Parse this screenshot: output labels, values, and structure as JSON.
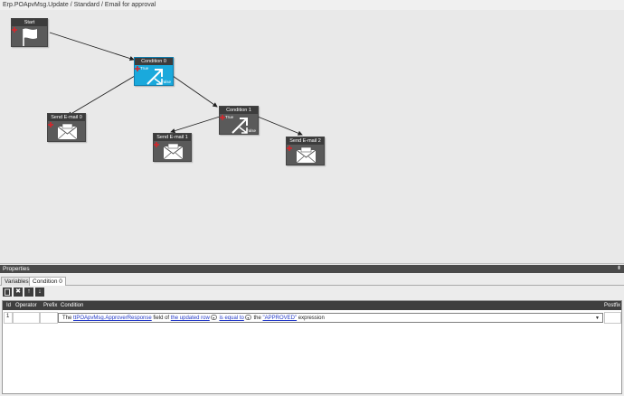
{
  "header": {
    "breadcrumb": "Erp.POApvMsg.Update / Standard / Email for approval"
  },
  "workflow": {
    "nodes": {
      "start": {
        "title": "Start",
        "icon": "flag-icon"
      },
      "condition_0": {
        "title": "Condition 0",
        "icon": "branch-arrow-icon",
        "true_label": "True",
        "false_label": "False",
        "selected": true
      },
      "condition_1": {
        "title": "Condition 1",
        "icon": "branch-arrow-icon",
        "true_label": "True",
        "false_label": "False"
      },
      "email_0": {
        "title": "Send E-mail 0",
        "icon": "envelope-icon"
      },
      "email_1": {
        "title": "Send E-mail 1",
        "icon": "envelope-icon"
      },
      "email_2": {
        "title": "Send E-mail 2",
        "icon": "envelope-icon"
      }
    },
    "connections": [
      {
        "from": "Start",
        "to": "Condition 0"
      },
      {
        "from": "Condition 0 (True)",
        "to": "Send E-mail 0"
      },
      {
        "from": "Condition 0 (False)",
        "to": "Condition 1"
      },
      {
        "from": "Condition 1 (True)",
        "to": "Send E-mail 1"
      },
      {
        "from": "Condition 1 (False)",
        "to": "Send E-mail 2"
      }
    ],
    "colors": {
      "selected_node": "#1aa9dc",
      "node": "#5a5a5a",
      "marker": "#d8262b"
    }
  },
  "properties": {
    "title": "Properties",
    "pin_icon": "pin-icon",
    "tabs": [
      {
        "label": "Variables"
      },
      {
        "label": "Condition 0",
        "active": true
      }
    ],
    "toolbar": {
      "new_icon": "new-row-icon",
      "delete_icon": "delete-icon",
      "move_up_icon": "arrow-up-icon",
      "move_down_icon": "arrow-down-icon",
      "delete_glyph": "✖",
      "up_glyph": "↑",
      "down_glyph": "↓"
    },
    "grid": {
      "columns": {
        "id": "Id",
        "operator": "Operator",
        "prefix": "Prefix",
        "condition": "Condition",
        "postfix": "Postfix"
      },
      "rows": [
        {
          "id": "1",
          "operator": "",
          "prefix": "",
          "condition": {
            "t1": "The",
            "field": "ttPOApvMsg.ApproverResponse",
            "t2": "field of",
            "row": "the updated row",
            "comparison": "is equal to",
            "t3": "the",
            "value": "\"APPROVED\"",
            "t4": "expression"
          },
          "postfix": ""
        }
      ]
    }
  }
}
